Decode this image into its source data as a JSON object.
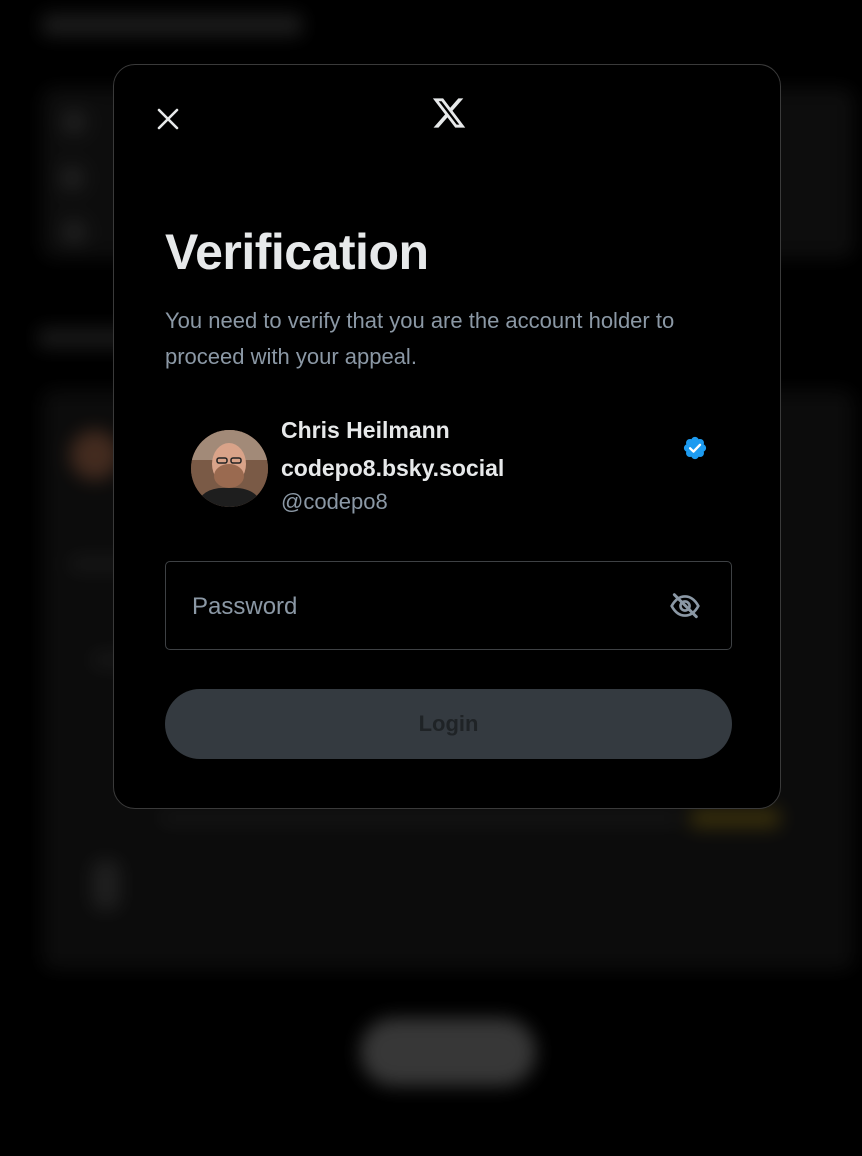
{
  "modal": {
    "title": "Verification",
    "subtitle": "You need to verify that you are the account holder to proceed with your appeal.",
    "close_icon": "close-icon",
    "logo_icon": "x-logo-icon"
  },
  "account": {
    "display_name": "Chris Heilmann codepo8.bsky.social",
    "handle": "@codepo8",
    "verified": true,
    "badge_color": "#1d9bf0"
  },
  "password": {
    "placeholder": "Password",
    "value": "",
    "toggle_icon": "eye-off-icon"
  },
  "login": {
    "label": "Login",
    "enabled": false
  },
  "colors": {
    "text_primary": "#e7e9ea",
    "text_secondary": "#8b98a5",
    "button_disabled_bg": "#343a40",
    "border": "#3e4144"
  }
}
